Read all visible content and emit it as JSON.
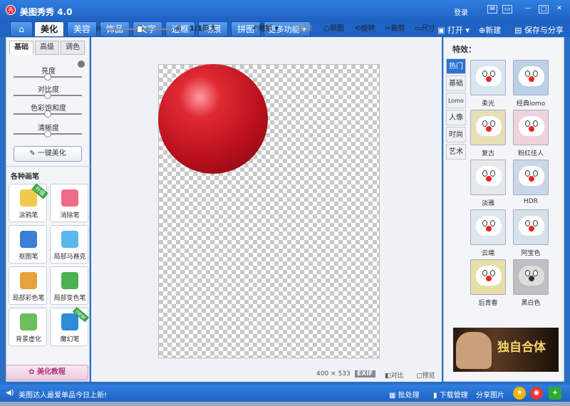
{
  "app": {
    "title": "美图秀秀 4.0",
    "logo_text": "秀",
    "login": "登录"
  },
  "tabs": [
    "美化",
    "美容",
    "饰品",
    "文字",
    "边框",
    "场景",
    "拼图",
    "更多功能"
  ],
  "topright": {
    "open": "打开",
    "new": "新建",
    "save": "保存与分享"
  },
  "toolbar": {
    "zoom_ratio": "1:1",
    "zoom_label": "原大",
    "undo": "撤销",
    "redo": "重做",
    "original": "原图",
    "rotate": "旋转",
    "crop": "裁剪",
    "size": "尺寸",
    "zoom_level": 0.5
  },
  "left": {
    "tabs": [
      "基础",
      "高级",
      "调色"
    ],
    "sliders": [
      {
        "label": "亮度",
        "value": 0.5
      },
      {
        "label": "对比度",
        "value": 0.5
      },
      {
        "label": "色彩饱和度",
        "value": 0.5
      },
      {
        "label": "清晰度",
        "value": 0.5
      }
    ],
    "onekey": "一键美化",
    "brush_header": "各种画笔",
    "brushes": [
      {
        "label": "涂鸦笔",
        "badge": "升级",
        "color": "#f2c94c"
      },
      {
        "label": "消除笔",
        "badge": "",
        "color": "#f06a8a"
      },
      {
        "label": "抠图笔",
        "badge": "",
        "color": "#3b7fd6"
      },
      {
        "label": "局部马赛克",
        "badge": "",
        "color": "#5cb6ee"
      },
      {
        "label": "局部彩色笔",
        "badge": "",
        "color": "#e6a23c"
      },
      {
        "label": "局部变色笔",
        "badge": "",
        "color": "#4caf50"
      },
      {
        "label": "背景虚化",
        "badge": "",
        "color": "#6cbf5c"
      },
      {
        "label": "魔幻笔",
        "badge": "new",
        "color": "#2f8bd8"
      }
    ],
    "tutorial": "美化教程"
  },
  "canvas": {
    "width_text": "400",
    "height_text": "533",
    "exif": "EXIF",
    "compare": "对比",
    "preview": "预览"
  },
  "right": {
    "header": "特效：",
    "tabs": [
      "热门",
      "基础",
      "Lomo",
      "人像",
      "时尚",
      "艺术"
    ],
    "effects": [
      {
        "label": "柔光",
        "bg": "#d9e6f0"
      },
      {
        "label": "经典lomo",
        "bg": "#bcd0e6"
      },
      {
        "label": "复古",
        "bg": "#e8dfb8"
      },
      {
        "label": "粉红佳人",
        "bg": "#f0d2dc"
      },
      {
        "label": "淡雅",
        "bg": "#e6eaec"
      },
      {
        "label": "HDR",
        "bg": "#c9d8e8"
      },
      {
        "label": "云端",
        "bg": "#dce8ee"
      },
      {
        "label": "阿宝色",
        "bg": "#d6e2ea"
      },
      {
        "label": "后青春",
        "bg": "#e6e0a8"
      },
      {
        "label": "黑白色",
        "bg": "#bfbfbf"
      }
    ],
    "ad_text": "独自合体"
  },
  "status": {
    "message": "美图达人最爱单品今日上新!",
    "batch": "批处理",
    "download": "下载管理",
    "share": "分享图片"
  }
}
